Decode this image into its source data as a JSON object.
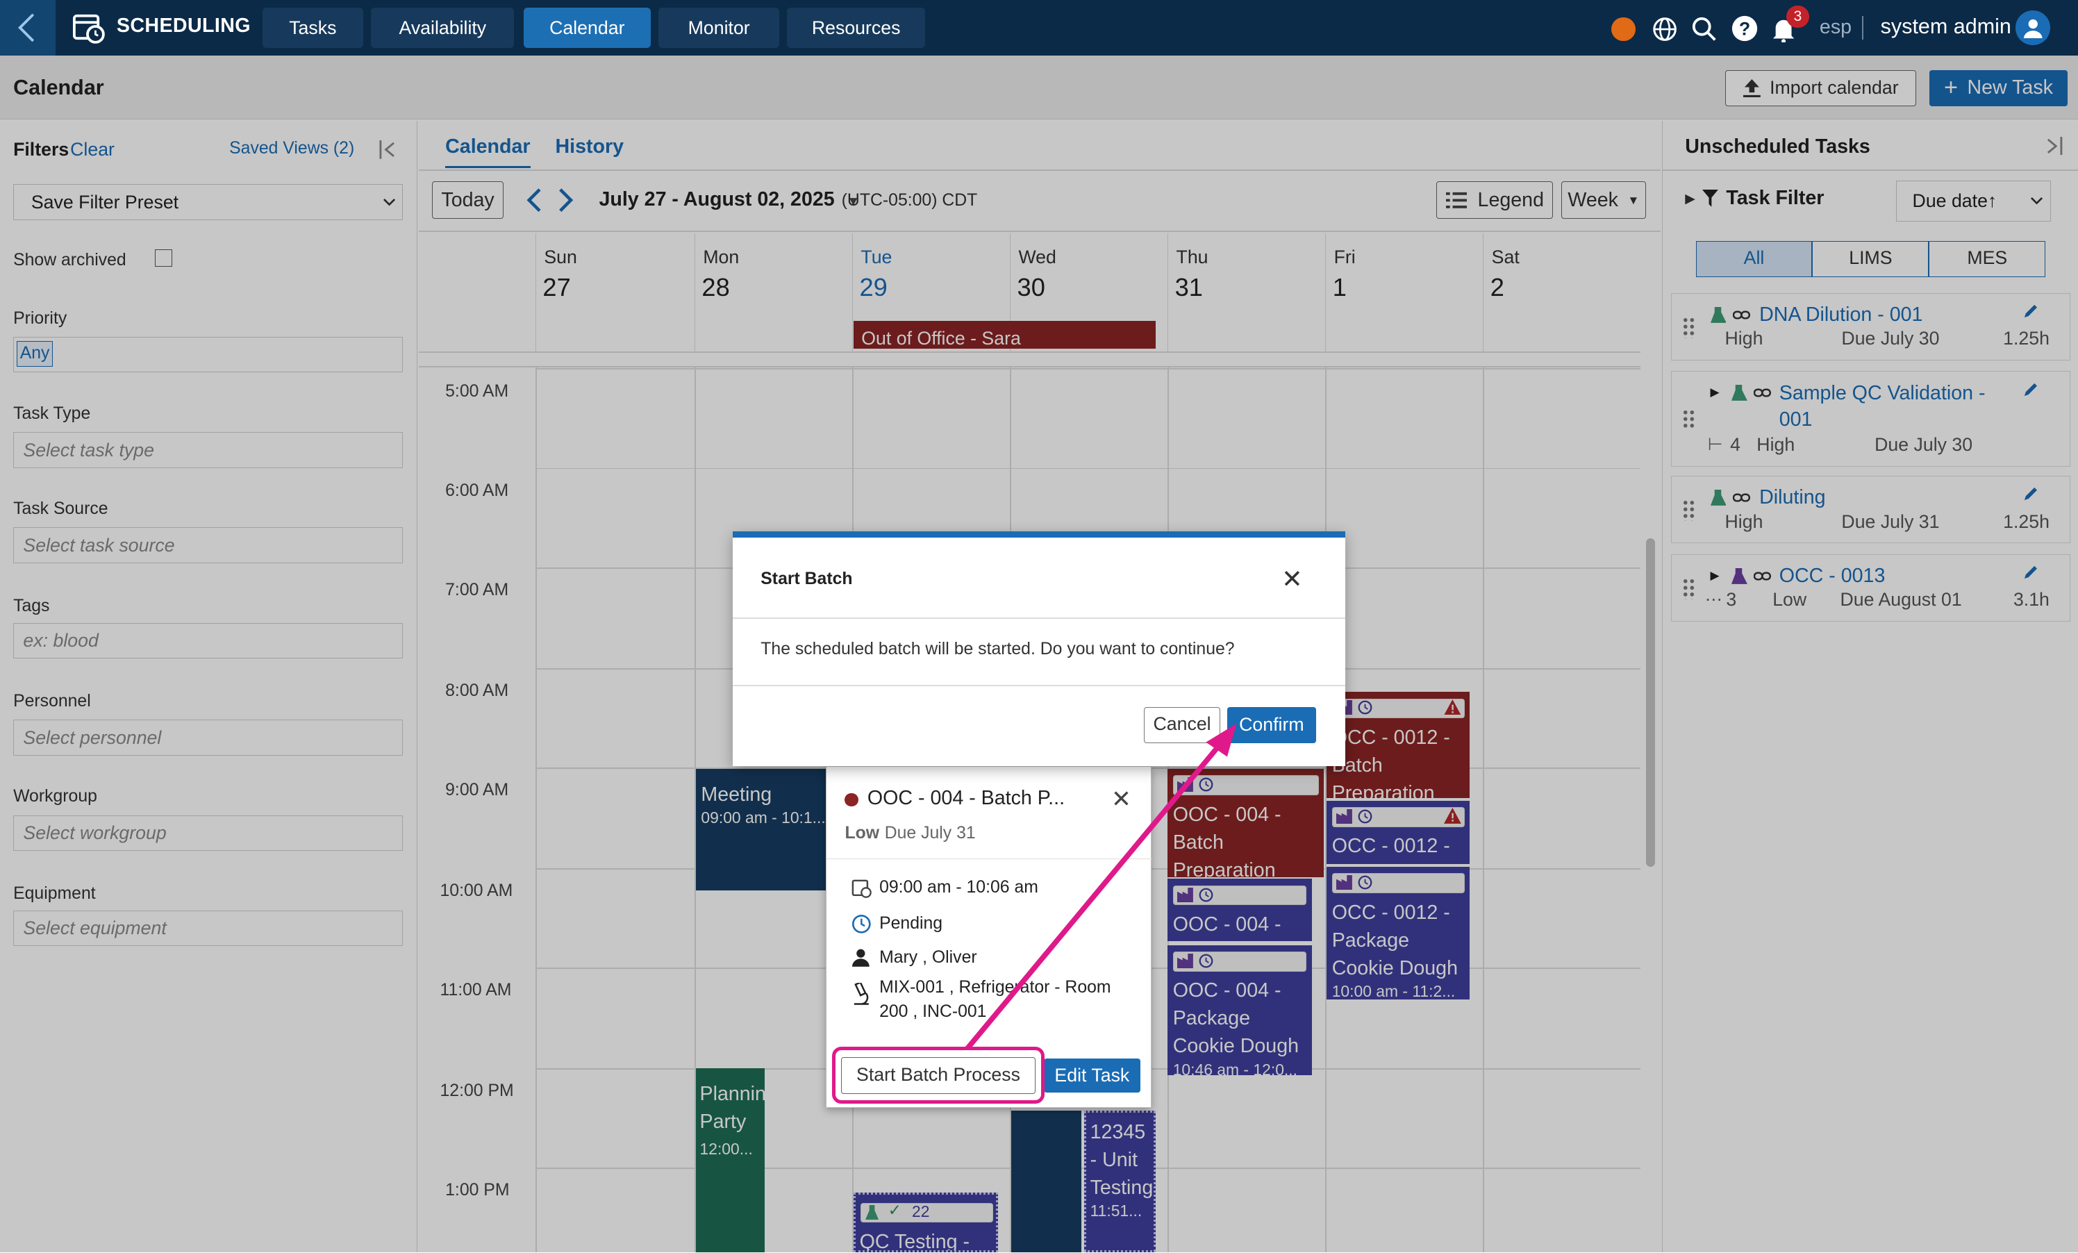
{
  "app": {
    "title": "SCHEDULING",
    "nav_tabs": [
      "Tasks",
      "Availability",
      "Calendar",
      "Monitor",
      "Resources"
    ],
    "active_tab": "Calendar",
    "notification_count": "3",
    "language": "esp",
    "user": "system admin"
  },
  "page": {
    "title": "Calendar",
    "import_label": "Import calendar",
    "new_task_label": "New Task"
  },
  "filters": {
    "heading": "Filters",
    "clear": "Clear",
    "saved_views": "Saved Views (2)",
    "preset": "Save Filter Preset",
    "show_archived": "Show archived",
    "priority_label": "Priority",
    "priority_value": "Any",
    "task_type_label": "Task Type",
    "task_type_placeholder": "Select task type",
    "task_source_label": "Task Source",
    "task_source_placeholder": "Select task source",
    "tags_label": "Tags",
    "tags_placeholder": "ex: blood",
    "personnel_label": "Personnel",
    "personnel_placeholder": "Select personnel",
    "workgroup_label": "Workgroup",
    "workgroup_placeholder": "Select workgroup",
    "equipment_label": "Equipment",
    "equipment_placeholder": "Select equipment"
  },
  "calendar": {
    "tabs": [
      "Calendar",
      "History"
    ],
    "today": "Today",
    "range": "July 27 - August 02, 2025",
    "timezone": "(UTC-05:00) CDT",
    "legend": "Legend",
    "view": "Week",
    "days": [
      {
        "name": "Sun",
        "num": "27"
      },
      {
        "name": "Mon",
        "num": "28"
      },
      {
        "name": "Tue",
        "num": "29"
      },
      {
        "name": "Wed",
        "num": "30"
      },
      {
        "name": "Thu",
        "num": "31"
      },
      {
        "name": "Fri",
        "num": "1"
      },
      {
        "name": "Sat",
        "num": "2"
      }
    ],
    "times": [
      "5:00 AM",
      "6:00 AM",
      "7:00 AM",
      "8:00 AM",
      "9:00 AM",
      "10:00 AM",
      "11:00 AM",
      "12:00 PM",
      "1:00 PM"
    ],
    "events": {
      "out_of_office": "Out of Office - Sara",
      "meeting_title": "Meeting",
      "meeting_time": "09:00 am - 10:1...",
      "planning_title": "Planning Party",
      "planning_time": "12:00...",
      "thu1": "OOC - 004 - Batch Preparation",
      "thu2": "OOC - 004 -",
      "thu3": "OOC - 004 - Package Cookie Dough",
      "thu3_time": "10:46 am - 12:0...",
      "fri1": "OCC - 0012 - Batch Preparation",
      "fri2": "OCC - 0012 -",
      "fri3": "OCC - 0012 - Package Cookie Dough",
      "fri3_time": "10:00 am - 11:2...",
      "wed_unit": "12345 - Unit Testing",
      "wed_unit_time": "11:51...",
      "qc_title": "QC Testing -",
      "qc_count": "22"
    }
  },
  "popover": {
    "title": "OOC - 004 - Batch P...",
    "priority": "Low",
    "due": "Due July 31",
    "time": "09:00 am - 10:06 am",
    "status": "Pending",
    "people": "Mary , Oliver",
    "equipment": "MIX-001 , Refrigerator - Room 200 , INC-001",
    "start_label": "Start Batch Process",
    "edit_label": "Edit Task"
  },
  "dialog": {
    "title": "Start Batch",
    "message": "The scheduled batch will be started. Do you want to continue?",
    "cancel": "Cancel",
    "confirm": "Confirm"
  },
  "unscheduled": {
    "title": "Unscheduled Tasks",
    "task_filter": "Task Filter",
    "sort": "Due date↑",
    "segments": [
      "All",
      "LIMS",
      "MES"
    ],
    "tasks": [
      {
        "name": "DNA Dilution - 001",
        "priority": "High",
        "due": "Due July 30",
        "dur": "1.25h"
      },
      {
        "name": "Sample QC Validation - 001",
        "priority": "High",
        "due": "Due July 30",
        "sub": "4"
      },
      {
        "name": "Diluting",
        "priority": "High",
        "due": "Due July 31",
        "dur": "1.25h"
      },
      {
        "name": "OCC - 0013",
        "priority": "Low",
        "due": "Due August 01",
        "dur": "3.1h",
        "sub": "3"
      }
    ]
  },
  "colors": {
    "nav": "#0b2a47",
    "accent": "#1a6cb5",
    "danger": "#8b2424",
    "purple": "#3f3f9e",
    "navy": "#173d62",
    "green": "#1e6e55",
    "highlight": "#e0198a"
  }
}
